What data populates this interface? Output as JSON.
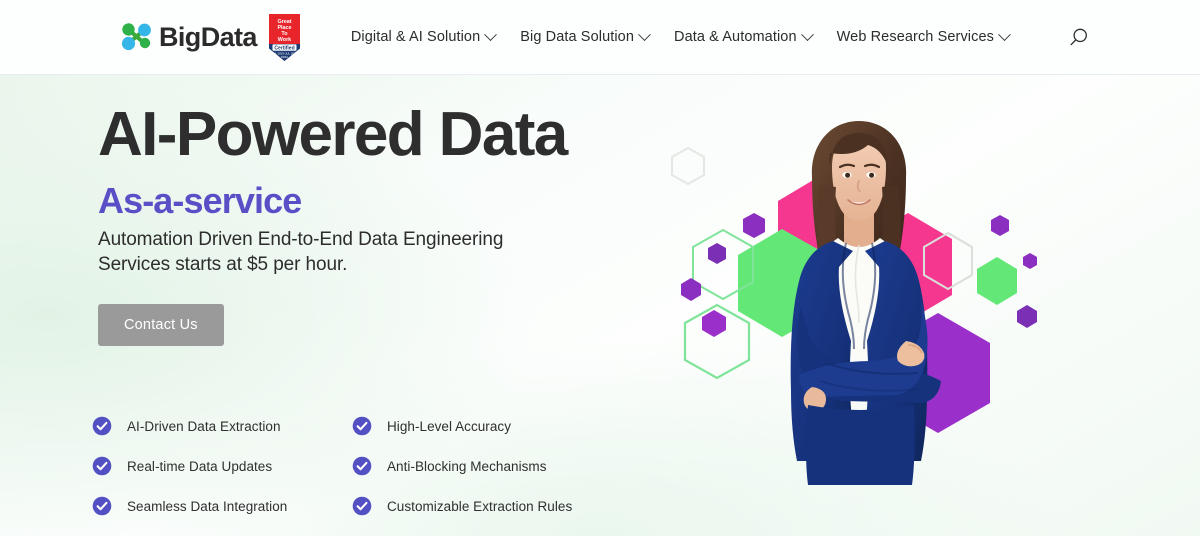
{
  "header": {
    "brand": {
      "logo_icon": "bigdata-molecule-logo",
      "name": "BigData",
      "badge": {
        "icon": "great-place-to-work-badge",
        "line1": "Great",
        "line2": "Place",
        "line3": "To",
        "line4": "Work",
        "certified": "Certified",
        "dates": "JUL 2023 - JUL 2024",
        "country": "INDIA",
        "color_red": "#e8252a",
        "color_navy": "#1d3b73"
      }
    },
    "nav": [
      {
        "label": "Digital & AI Solution",
        "has_dropdown": true
      },
      {
        "label": "Big Data Solution",
        "has_dropdown": true
      },
      {
        "label": "Data & Automation",
        "has_dropdown": true
      },
      {
        "label": "Web Research Services",
        "has_dropdown": true
      }
    ],
    "search": {
      "icon": "search-icon",
      "label": "Search"
    }
  },
  "hero": {
    "title": "AI-Powered Data",
    "subtitle": "As-a-service",
    "subtitle_color": "#5b4fc8",
    "lead": "Automation Driven End-to-End Data Engineering Services starts at $5 per hour.",
    "cta": {
      "label": "Contact Us",
      "bg": "#9a9a9a",
      "text_color": "#ffffff"
    },
    "image": {
      "alt": "businesswoman-with-arms-crossed",
      "decor": "hexagon-cluster"
    },
    "features": [
      {
        "icon": "check-circle-icon",
        "label": "AI-Driven Data Extraction"
      },
      {
        "icon": "check-circle-icon",
        "label": "High-Level Accuracy"
      },
      {
        "icon": "check-circle-icon",
        "label": "Real-time Data Updates"
      },
      {
        "icon": "check-circle-icon",
        "label": "Anti-Blocking Mechanisms"
      },
      {
        "icon": "check-circle-icon",
        "label": "Seamless Data Integration"
      },
      {
        "icon": "check-circle-icon",
        "label": "Customizable Extraction Rules"
      }
    ],
    "accent_colors": {
      "check": "#5350c4",
      "hex_pink": "#f6378f",
      "hex_green": "#63e878",
      "hex_purple": "#9b2fc9",
      "hex_violet": "#7b2fb5",
      "jacket_navy": "#16327c"
    }
  }
}
